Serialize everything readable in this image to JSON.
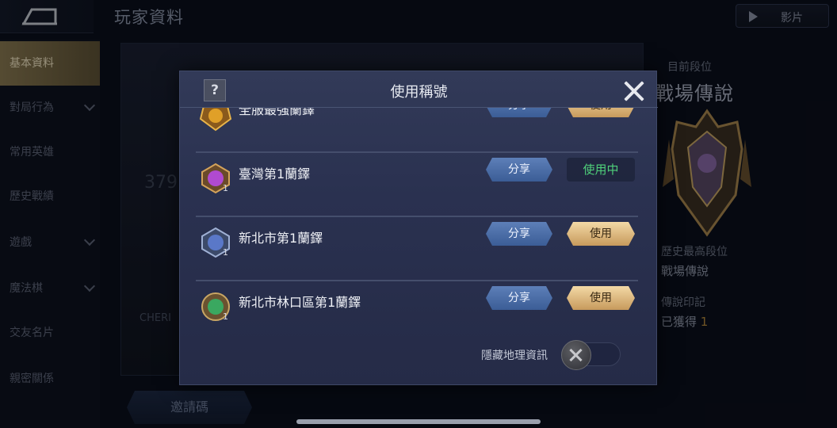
{
  "page": {
    "title": "玩家資料",
    "video_label": "影片"
  },
  "sidebar": {
    "items": [
      {
        "label": "基本資料",
        "active": true,
        "expandable": false
      },
      {
        "label": "對局行為",
        "active": false,
        "expandable": true
      },
      {
        "label": "常用英雄",
        "active": false,
        "expandable": false
      },
      {
        "label": "歷史戰績",
        "active": false,
        "expandable": false
      },
      {
        "label": "遊戲",
        "active": false,
        "expandable": true
      },
      {
        "label": "魔法棋",
        "active": false,
        "expandable": true
      },
      {
        "label": "交友名片",
        "active": false,
        "expandable": false
      },
      {
        "label": "親密關係",
        "active": false,
        "expandable": false
      }
    ]
  },
  "background": {
    "number": "379",
    "cheri": "CHERI"
  },
  "rank": {
    "current_label": "目前段位",
    "current_name": "戰場傳說",
    "best_label": "歷史最高段位",
    "best_name": "戰場傳說",
    "legend_label": "傳說印記",
    "legend_prefix": "已獲得",
    "legend_count": "1"
  },
  "invite": {
    "label": "邀請碼"
  },
  "modal": {
    "help": "?",
    "title": "使用稱號",
    "titles": [
      {
        "name": "全服最強蘭鐸",
        "share": "分享",
        "action": "使用",
        "in_use": false,
        "level": "",
        "gem": "#e0a028"
      },
      {
        "name": "臺灣第1蘭鐸",
        "share": "分享",
        "action": "使用中",
        "in_use": true,
        "level": "1",
        "gem": "#b04ad0"
      },
      {
        "name": "新北市第1蘭鐸",
        "share": "分享",
        "action": "使用",
        "in_use": false,
        "level": "1",
        "gem": "#5a78c8"
      },
      {
        "name": "新北市林口區第1蘭鐸",
        "share": "分享",
        "action": "使用",
        "in_use": false,
        "level": "1",
        "gem": "#3aa860"
      }
    ],
    "hide_location_label": "隱藏地理資訊",
    "hide_location_on": false
  },
  "colors": {
    "accent_gold": "#c79a5c",
    "share_blue": "#4a6ca6",
    "in_use_green": "#4fd07a"
  }
}
